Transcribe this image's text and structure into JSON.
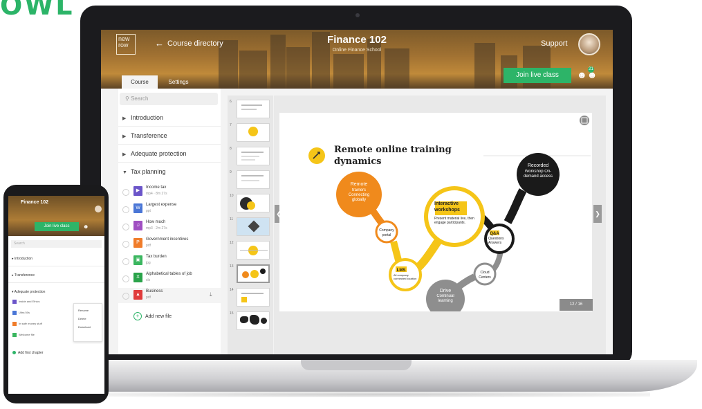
{
  "brand": "OWL",
  "header": {
    "logo_text": "new row",
    "back_label": "Course directory",
    "title": "Finance 102",
    "subtitle": "Online Finance School",
    "support_label": "Support",
    "join_label": "Join live class",
    "participants_count": "21",
    "tabs": [
      {
        "label": "Course"
      },
      {
        "label": "Settings"
      }
    ]
  },
  "sidebar": {
    "search_placeholder": "Search",
    "chapters": [
      {
        "label": "Introduction"
      },
      {
        "label": "Transference"
      },
      {
        "label": "Adequate protection"
      },
      {
        "label": "Tax planning"
      }
    ],
    "files": [
      {
        "name": "Income tax",
        "meta": "mp4 · 8m 27s",
        "icon": "video-icon",
        "color": "#6b55c9"
      },
      {
        "name": "Largest expense",
        "meta": "ppt",
        "icon": "doc-icon",
        "color": "#4a76d6"
      },
      {
        "name": "How much",
        "meta": "mp3 · 2m 27s",
        "icon": "audio-icon",
        "color": "#a04fc2"
      },
      {
        "name": "Government incentives",
        "meta": "pdf",
        "icon": "presentation-icon",
        "color": "#f07c2a"
      },
      {
        "name": "Tax burden",
        "meta": "jpg",
        "icon": "image-icon",
        "color": "#3ab65f"
      },
      {
        "name": "Alphabetical tables of job",
        "meta": "xls",
        "icon": "sheet-icon",
        "color": "#2aa34a"
      },
      {
        "name": "Business",
        "meta": "pdf",
        "icon": "pdf-icon",
        "color": "#e03b3b"
      }
    ],
    "add_file_label": "Add new file"
  },
  "thumbnails": [
    {
      "num": "6"
    },
    {
      "num": "7"
    },
    {
      "num": "8"
    },
    {
      "num": "9"
    },
    {
      "num": "10"
    },
    {
      "num": "11"
    },
    {
      "num": "12"
    },
    {
      "num": "13"
    },
    {
      "num": "14"
    },
    {
      "num": "15"
    }
  ],
  "slide": {
    "title_line1": "Remote online training",
    "title_line2": "dynamics",
    "nodes": [
      {
        "title": "Remote",
        "text": "trainers Connecting globally",
        "color": "#f08a1c",
        "text_color": "#ffffff"
      },
      {
        "title": "Interactive workshops",
        "text": "Present material live, then engage participants.",
        "color": "#f5c518",
        "text_color": "#222222"
      },
      {
        "title": "Recorded",
        "text": "Workshop On-demand access",
        "color": "#1a1a1a",
        "text_color": "#ffffff"
      },
      {
        "title": "Company",
        "text": "portal",
        "color": "#f08a1c",
        "text_color": "#222222"
      },
      {
        "title": "LMS",
        "text": "All company connected location",
        "color": "#f5c518",
        "text_color": "#222222"
      },
      {
        "title": "Q&A",
        "text": "Questions Answers",
        "color": "#1a1a1a",
        "text_color": "#222222"
      },
      {
        "title": "Cloud",
        "text": "Centers",
        "color": "#8e8e8e",
        "text_color": "#222222"
      },
      {
        "title": "Drive",
        "text": "Continual learning",
        "color": "#8e8e8e",
        "text_color": "#ffffff"
      }
    ],
    "page_indicator": "12 / 16"
  },
  "phone": {
    "title": "Finance 102",
    "join_label": "Join live class",
    "search_placeholder": "Search",
    "chapters": [
      {
        "label": "Introduction"
      },
      {
        "label": "Transference"
      },
      {
        "label": "Adequate protection"
      }
    ],
    "files": [
      {
        "name": "Inside and Ethics",
        "color": "#6b55c9"
      },
      {
        "name": "Ultra 50s",
        "color": "#4a76d6"
      },
      {
        "name": "In safe money stuff",
        "color": "#f07c2a"
      },
      {
        "name": "Welcome file",
        "color": "#3ab65f"
      }
    ],
    "menu": [
      {
        "label": "Rename"
      },
      {
        "label": "Delete"
      },
      {
        "label": "Download"
      }
    ],
    "add_chapter_label": "Add first chapter"
  }
}
